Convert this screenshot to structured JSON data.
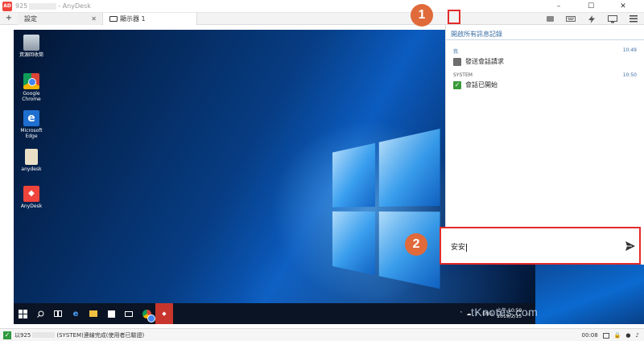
{
  "window": {
    "logo": "AD",
    "title_prefix": "925",
    "title_suffix": "- AnyDesk",
    "minimize": "–",
    "maximize": "☐",
    "close": "✕"
  },
  "tabs": {
    "add": "+",
    "settings_label": "設定",
    "display_label": "顯示器 1",
    "close": "✕"
  },
  "toolbar": {
    "keyboard_icon": "keyboard-icon",
    "actions_icon": "lightning-icon",
    "display_icon": "monitor-icon",
    "menu_icon": "hamburger-icon"
  },
  "chat": {
    "header": "開啟所有訊息記錄",
    "messages": [
      {
        "sender": "我",
        "time": "10:49",
        "text": "發送會話請求",
        "sender_color": "#3b6fa6"
      },
      {
        "sender": "SYSTEM",
        "time": "10:50",
        "text": "會話已開始",
        "sender_color": "#555555"
      }
    ],
    "input_value": "安安"
  },
  "desktop": {
    "icons": [
      {
        "label": "資源回收筒",
        "icon": "recycle-bin-icon"
      },
      {
        "label": "Google Chrome",
        "icon": "chrome-icon"
      },
      {
        "label": "Microsoft Edge",
        "icon": "edge-icon"
      },
      {
        "label": "anydesk",
        "icon": "folder-icon"
      },
      {
        "label": "AnyDesk",
        "icon": "anydesk-icon"
      }
    ],
    "taskbar": {
      "lang": "ENG",
      "time": "上午 10:59",
      "date": "2019/2/15"
    }
  },
  "markers": {
    "one": "1",
    "two": "2"
  },
  "status": {
    "prefix": "以925",
    "message": "(SYSTEM)連線完成(使用者已驗證)",
    "timer": "00:08"
  },
  "watermark": "tKnotes.com",
  "colors": {
    "accent_red": "#e32a2a",
    "marker": "#e06a3a",
    "link_blue": "#3b6fa6"
  }
}
